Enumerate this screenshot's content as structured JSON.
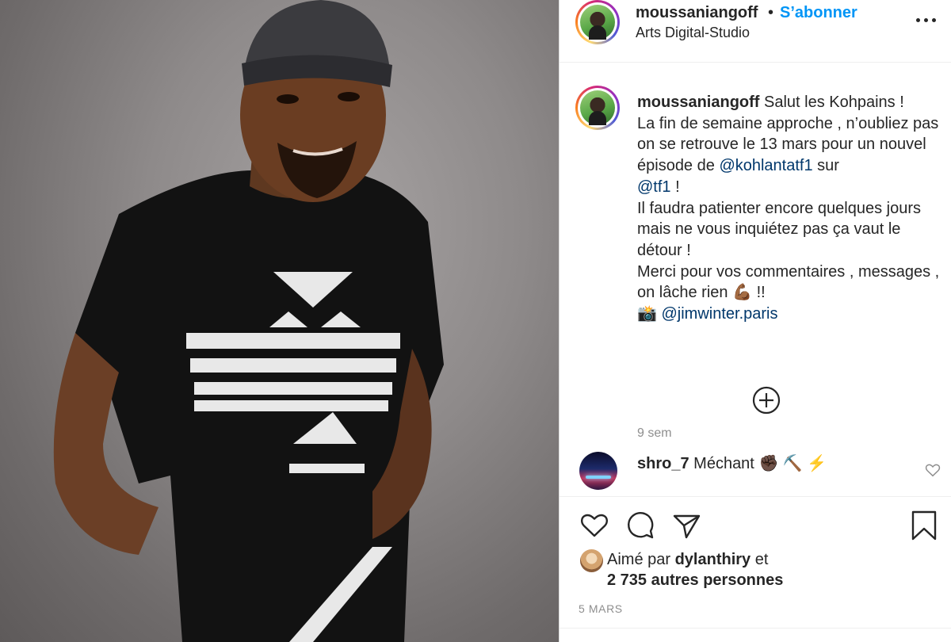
{
  "header": {
    "username": "moussaniangoff",
    "separator": "•",
    "follow_label": "S’abonner",
    "location": "Arts Digital-Studio",
    "more_icon": "more-horizontal-icon"
  },
  "caption": {
    "username": "moussaniangoff",
    "line1": "Salut les Kohpains !",
    "line2": "La fin de semaine approche , n’oubliez pas on se retrouve le 13 mars pour un nouvel épisode de",
    "mention1": "@kohlantatf1",
    "word_sur": "sur",
    "mention2": "@tf1",
    "excl": "!",
    "line3": "Il faudra patienter encore quelques jours mais ne vous inquiétez pas ça vaut le détour !",
    "line4": "Merci pour vos commentaires , messages , on lâche rien",
    "emoji_muscle": "💪🏾",
    "excl2": "!!",
    "emoji_camera": "📸",
    "mention3": "@jimwinter.paris",
    "time": "9 sem"
  },
  "load_more_icon": "plus-circle-icon",
  "comment": {
    "username": "shro_7",
    "text": "Méchant",
    "emojis": "✊🏿 ⛏️ ⚡",
    "like_icon": "heart-icon"
  },
  "actions": {
    "icons": [
      "heart-icon",
      "comment-icon",
      "share-icon",
      "bookmark-icon"
    ]
  },
  "likes": {
    "prefix": "Aimé par",
    "user": "dylanthiry",
    "suffix": "et",
    "count_text": "2 735 autres personnes"
  },
  "date": "5 MARS",
  "colors": {
    "accent": "#0095f6",
    "mention": "#00376b",
    "muted": "#8e8e8e",
    "text": "#262626"
  }
}
